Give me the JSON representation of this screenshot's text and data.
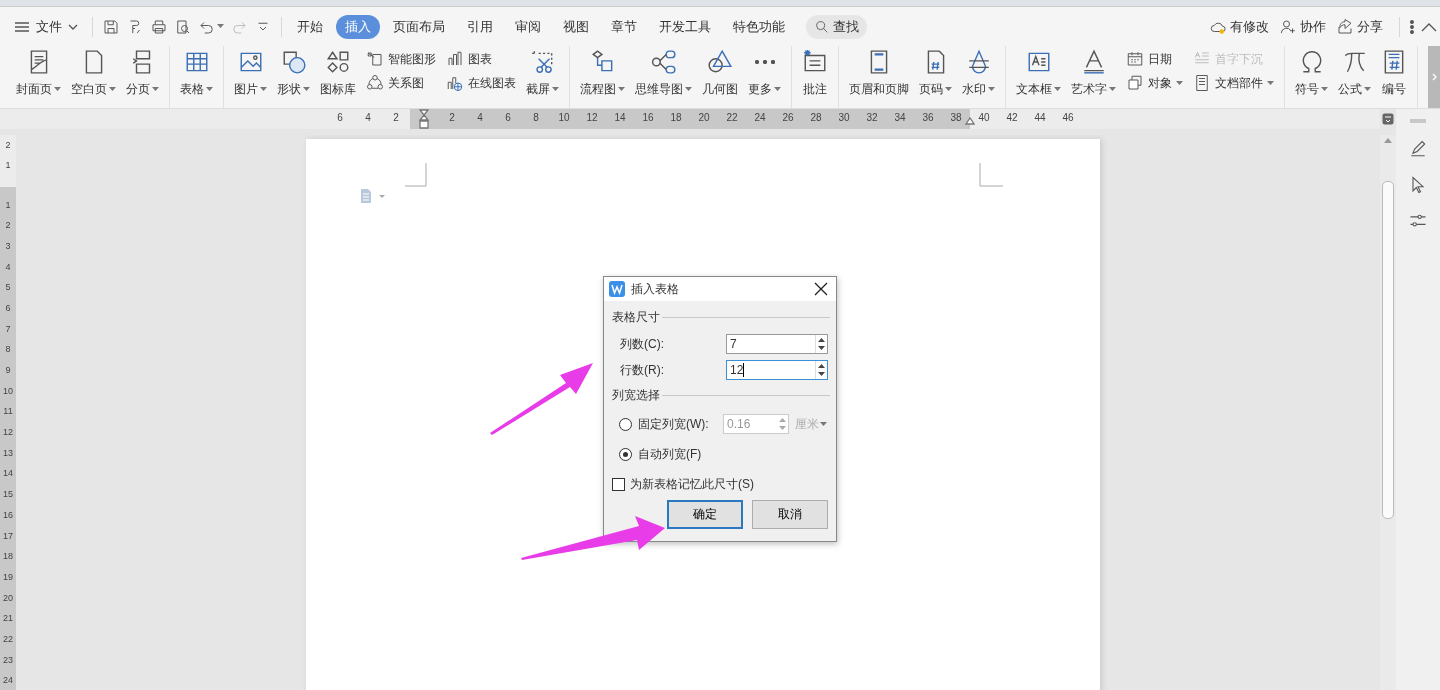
{
  "menu_bar": {
    "file_menu": "文件",
    "tabs": [
      {
        "label": "开始",
        "selected": false
      },
      {
        "label": "插入",
        "selected": true
      },
      {
        "label": "页面布局",
        "selected": false
      },
      {
        "label": "引用",
        "selected": false
      },
      {
        "label": "审阅",
        "selected": false
      },
      {
        "label": "视图",
        "selected": false
      },
      {
        "label": "章节",
        "selected": false
      },
      {
        "label": "开发工具",
        "selected": false
      },
      {
        "label": "特色功能",
        "selected": false
      }
    ],
    "search": "查找",
    "actions": [
      "有修改",
      "协作",
      "分享"
    ]
  },
  "ribbon": {
    "groups": [
      {
        "items": [
          {
            "kind": "large",
            "label": "封面页",
            "dropdown": true
          },
          {
            "kind": "large",
            "label": "空白页",
            "dropdown": true
          },
          {
            "kind": "large",
            "label": "分页",
            "dropdown": true
          }
        ]
      },
      {
        "items": [
          {
            "kind": "large",
            "label": "表格",
            "dropdown": true
          }
        ]
      },
      {
        "items": [
          {
            "kind": "large",
            "label": "图片",
            "dropdown": true
          },
          {
            "kind": "large",
            "label": "形状",
            "dropdown": true
          },
          {
            "kind": "large",
            "label": "图标库",
            "dropdown": false
          },
          {
            "kind": "pair",
            "items": [
              {
                "label": "智能图形",
                "dropdown": false,
                "disabled": false
              },
              {
                "label": "关系图",
                "dropdown": false,
                "disabled": false
              }
            ]
          },
          {
            "kind": "pair",
            "items": [
              {
                "label": "图表",
                "dropdown": false,
                "disabled": false
              },
              {
                "label": "在线图表",
                "dropdown": false,
                "disabled": false
              }
            ]
          },
          {
            "kind": "large",
            "label": "截屏",
            "dropdown": true
          }
        ]
      },
      {
        "items": [
          {
            "kind": "large",
            "label": "流程图",
            "dropdown": true
          },
          {
            "kind": "large",
            "label": "思维导图",
            "dropdown": true
          },
          {
            "kind": "large",
            "label": "几何图",
            "dropdown": false
          },
          {
            "kind": "large",
            "label": "更多",
            "dropdown": true
          }
        ]
      },
      {
        "items": [
          {
            "kind": "large",
            "label": "批注",
            "dropdown": false
          }
        ]
      },
      {
        "items": [
          {
            "kind": "large",
            "label": "页眉和页脚",
            "dropdown": false
          },
          {
            "kind": "large",
            "label": "页码",
            "dropdown": true
          },
          {
            "kind": "large",
            "label": "水印",
            "dropdown": true
          }
        ]
      },
      {
        "items": [
          {
            "kind": "large",
            "label": "文本框",
            "dropdown": true
          },
          {
            "kind": "large",
            "label": "艺术字",
            "dropdown": true
          },
          {
            "kind": "pair",
            "items": [
              {
                "label": "日期",
                "dropdown": false,
                "disabled": false
              },
              {
                "label": "对象",
                "dropdown": true,
                "disabled": false
              }
            ]
          },
          {
            "kind": "pair",
            "items": [
              {
                "label": "首字下沉",
                "dropdown": false,
                "disabled": true
              },
              {
                "label": "文档部件",
                "dropdown": true,
                "disabled": false
              }
            ]
          }
        ]
      },
      {
        "items": [
          {
            "kind": "large",
            "label": "符号",
            "dropdown": true
          },
          {
            "kind": "large",
            "label": "公式",
            "dropdown": true
          },
          {
            "kind": "large",
            "label": "编号",
            "dropdown": false
          }
        ]
      }
    ]
  },
  "ruler": {
    "left_ticks": [
      "6",
      "4",
      "2"
    ],
    "ticks": [
      "2",
      "4",
      "6",
      "8",
      "10",
      "12",
      "14",
      "16",
      "18",
      "20",
      "22",
      "24",
      "26",
      "28",
      "30",
      "32",
      "34",
      "36",
      "38"
    ],
    "right_ticks": [
      "40",
      "42",
      "44",
      "46"
    ]
  },
  "vertical_ruler": {
    "top_ticks": [
      "2",
      "1"
    ],
    "ticks": [
      "1",
      "2",
      "3",
      "4",
      "5",
      "6",
      "7",
      "8",
      "9",
      "10",
      "11",
      "12",
      "13",
      "14",
      "15",
      "16",
      "17",
      "18",
      "19",
      "20",
      "21",
      "22",
      "23",
      "24"
    ]
  },
  "dialog": {
    "title": "插入表格",
    "size_group": {
      "legend": "表格尺寸",
      "fields": [
        {
          "label": "列数(C):",
          "value": "7",
          "focused": false
        },
        {
          "label": "行数(R):",
          "value": "12",
          "focused": true
        }
      ]
    },
    "width_group": {
      "legend": "列宽选择",
      "options": [
        {
          "label": "固定列宽(W):",
          "selected": false,
          "value": "0.16",
          "disabled": true,
          "unit": "厘米"
        },
        {
          "label": "自动列宽(F)",
          "selected": true
        }
      ]
    },
    "remember": {
      "label": "为新表格记忆此尺寸(S)",
      "checked": false
    },
    "buttons": [
      {
        "label": "确定",
        "default": true
      },
      {
        "label": "取消",
        "default": false
      }
    ]
  }
}
